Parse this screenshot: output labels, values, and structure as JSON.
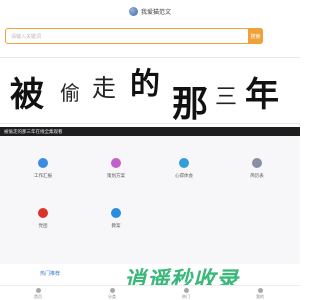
{
  "header": {
    "title": "我爱猫范文",
    "logo_icon": "globe-icon"
  },
  "search": {
    "placeholder": "请输入关键词",
    "button_label": "搜索"
  },
  "banner": {
    "text": "被偷走的那三年"
  },
  "news": {
    "text": "被偷走的那三年在线全集观看"
  },
  "grid": [
    {
      "label": "工作汇报",
      "icon": "chat-icon",
      "color": "#3b8de0"
    },
    {
      "label": "策划方案",
      "icon": "smile-icon",
      "color": "#c261c9"
    },
    {
      "label": "心得体会",
      "icon": "bulb-icon",
      "color": "#2f9fd6"
    },
    {
      "label": "简历表",
      "icon": "users-icon",
      "color": "#8a8fa3"
    },
    {
      "label": "党团",
      "icon": "party-icon",
      "color": "#d8342b"
    },
    {
      "label": "教案",
      "icon": "graduation-cap-icon",
      "color": "#2a8ddd"
    }
  ],
  "more": {
    "label": "热门推荐"
  },
  "watermark": {
    "text": "逍遥秒收录"
  },
  "bottom_nav": [
    {
      "label": "首页",
      "icon": "home-icon"
    },
    {
      "label": "分类",
      "icon": "grid-icon"
    },
    {
      "label": "热门",
      "icon": "fire-icon"
    },
    {
      "label": "我的",
      "icon": "user-icon"
    }
  ]
}
